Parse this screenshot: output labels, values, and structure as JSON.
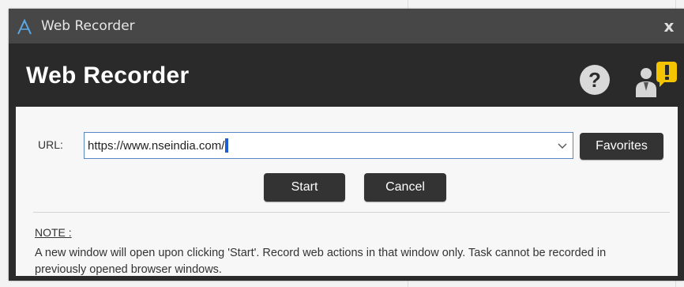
{
  "window": {
    "title": "Web Recorder",
    "close_symbol": "x"
  },
  "header": {
    "title": "Web Recorder",
    "help_symbol": "?",
    "icons": [
      "help-icon",
      "user-alert-icon"
    ]
  },
  "form": {
    "url_label": "URL:",
    "url_value": "https://www.nseindia.com/",
    "favorites_label": "Favorites",
    "start_label": "Start",
    "cancel_label": "Cancel"
  },
  "note": {
    "title": "NOTE :",
    "text": "A new window will open upon clicking 'Start'. Record web actions in that window only. Task cannot be recorded in previously opened browser windows."
  },
  "colors": {
    "titlebar": "#474747",
    "header": "#2a2a2a",
    "button": "#333333",
    "alert": "#f5c400",
    "url_border": "#5b86c9"
  }
}
